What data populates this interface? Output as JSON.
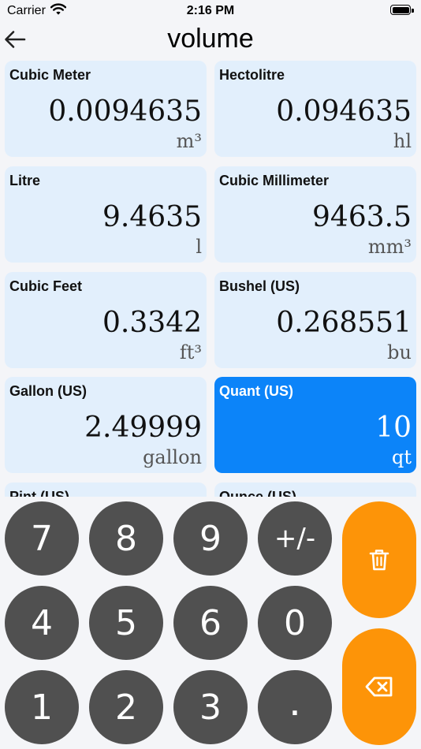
{
  "status": {
    "carrier": "Carrier",
    "time": "2:16 PM"
  },
  "header": {
    "title": "volume"
  },
  "units": [
    {
      "label": "Cubic Meter",
      "value": "0.0094635",
      "unit": "m³"
    },
    {
      "label": "Hectolitre",
      "value": "0.094635",
      "unit": "hl"
    },
    {
      "label": "Litre",
      "value": "9.4635",
      "unit": "l"
    },
    {
      "label": "Cubic Millimeter",
      "value": "9463.5",
      "unit": "mm³"
    },
    {
      "label": "Cubic Feet",
      "value": "0.3342",
      "unit": "ft³"
    },
    {
      "label": "Bushel (US)",
      "value": "0.268551",
      "unit": "bu"
    },
    {
      "label": "Gallon (US)",
      "value": "2.49999",
      "unit": "gallon"
    },
    {
      "label": "Quant (US)",
      "value": "10",
      "unit": "qt",
      "selected": true
    },
    {
      "label": "Pint (US)"
    },
    {
      "label": "Ounce (US)"
    }
  ],
  "keypad": {
    "keys": [
      "7",
      "8",
      "9",
      "+/-",
      "4",
      "5",
      "6",
      "0",
      "1",
      "2",
      "3",
      "."
    ],
    "clear_icon": "trash-icon",
    "backspace_icon": "backspace-icon"
  },
  "colors": {
    "selected_card": "#0c84f9",
    "card": "#e2effc",
    "key": "#505050",
    "action": "#fd9408"
  }
}
